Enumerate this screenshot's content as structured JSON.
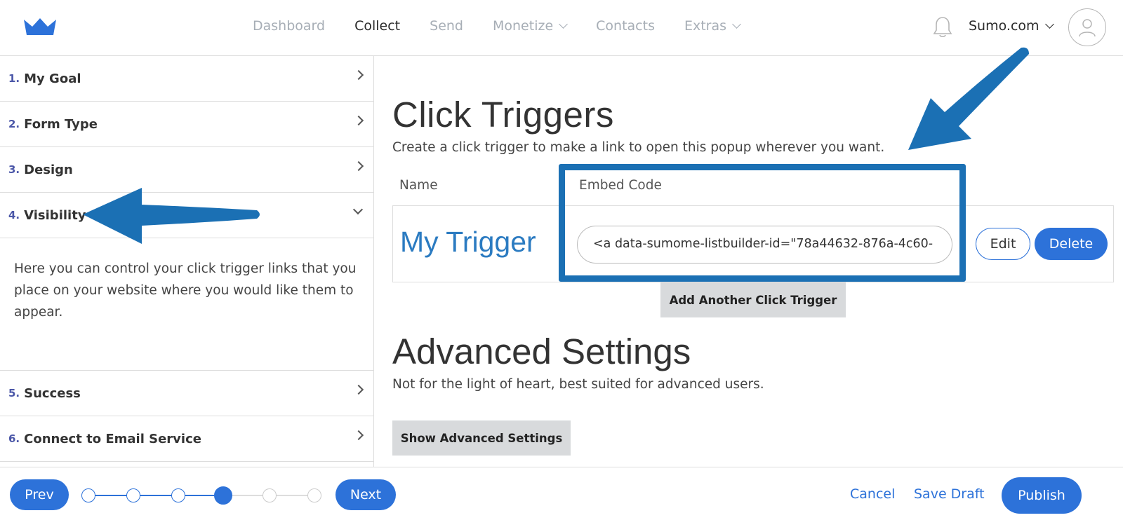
{
  "brand": {
    "logo_icon": "crown-icon",
    "accent": "#2d72d9",
    "annotation_color": "#1b70b4"
  },
  "nav": {
    "items": [
      {
        "label": "Dashboard",
        "active": false,
        "has_menu": false
      },
      {
        "label": "Collect",
        "active": true,
        "has_menu": false
      },
      {
        "label": "Send",
        "active": false,
        "has_menu": false
      },
      {
        "label": "Monetize",
        "active": false,
        "has_menu": true
      },
      {
        "label": "Contacts",
        "active": false,
        "has_menu": false
      },
      {
        "label": "Extras",
        "active": false,
        "has_menu": true
      }
    ],
    "account_label": "Sumo.com",
    "bell_icon": "bell-icon",
    "avatar_icon": "user-icon"
  },
  "sidebar": {
    "steps": [
      {
        "num": "1.",
        "label": "My Goal",
        "expanded": false
      },
      {
        "num": "2.",
        "label": "Form Type",
        "expanded": false
      },
      {
        "num": "3.",
        "label": "Design",
        "expanded": false
      },
      {
        "num": "4.",
        "label": "Visibility",
        "expanded": true
      },
      {
        "num": "5.",
        "label": "Success",
        "expanded": false
      },
      {
        "num": "6.",
        "label": "Connect to Email Service",
        "expanded": false
      }
    ],
    "visibility_description": "Here you can control your click trigger links that you place on your website where you would like them to appear."
  },
  "main": {
    "title": "Click Triggers",
    "subtitle": "Create a click trigger to make a link to open this popup wherever you want.",
    "columns": {
      "name": "Name",
      "embed": "Embed Code"
    },
    "trigger": {
      "name": "My Trigger",
      "embed_code": "<a data-sumome-listbuilder-id=\"78a44632-876a-4c60-",
      "edit_label": "Edit",
      "delete_label": "Delete"
    },
    "add_trigger_label": "Add Another Click Trigger",
    "advanced_title": "Advanced Settings",
    "advanced_subtitle": "Not for the light of heart, best suited for advanced users.",
    "show_advanced_label": "Show Advanced Settings"
  },
  "footer": {
    "prev_label": "Prev",
    "next_label": "Next",
    "cancel_label": "Cancel",
    "save_draft_label": "Save Draft",
    "publish_label": "Publish",
    "progress": {
      "total_steps": 6,
      "current_step": 4
    }
  }
}
